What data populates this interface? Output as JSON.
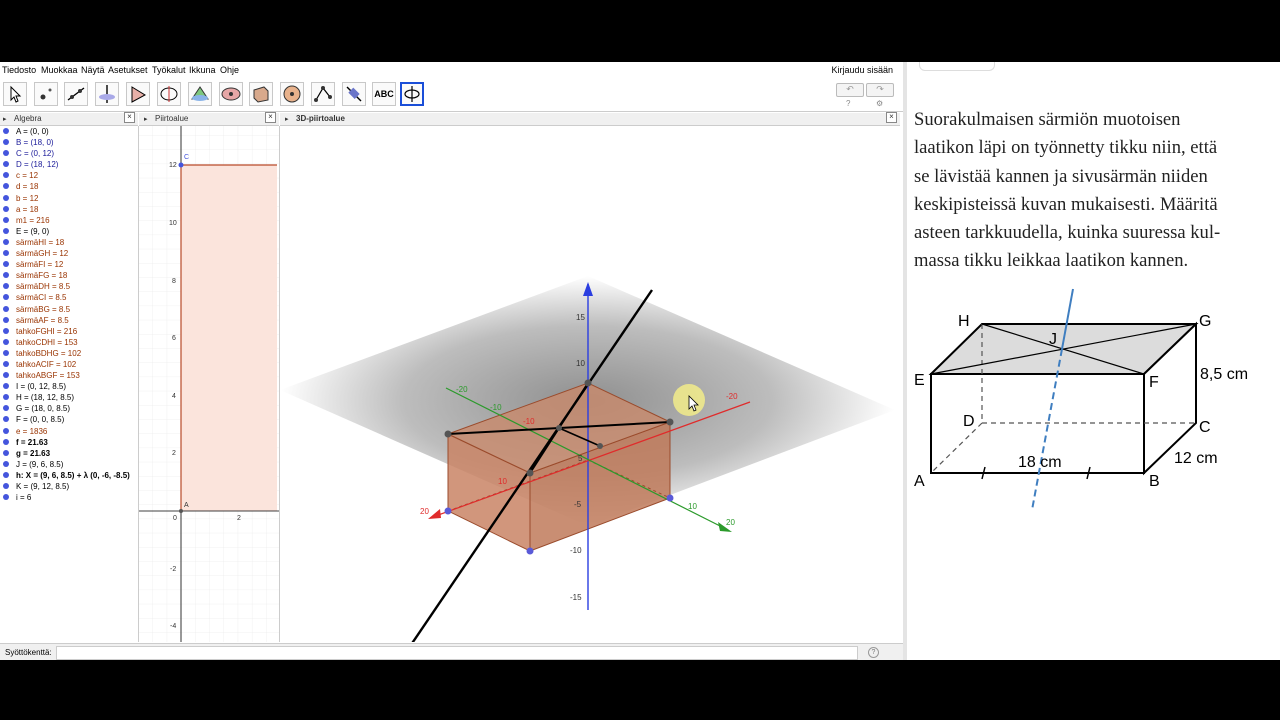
{
  "menu": {
    "items": [
      "Tiedosto",
      "Muokkaa",
      "Näytä",
      "Asetukset",
      "Työkalut",
      "Ikkuna",
      "Ohje"
    ],
    "login": "Kirjaudu sisään"
  },
  "toolbar": {
    "tools": [
      "move-tool",
      "point-tool",
      "line-tool",
      "perpendicular-tool",
      "polygon-tool",
      "circle-tool",
      "intersect-tool",
      "sphere-tool",
      "extrude-tool",
      "pyramid-tool",
      "angle-tool",
      "reflect-tool",
      "text-tool",
      "rotate-view-tool"
    ],
    "text_tool_label": "ABC",
    "undo_symbol": "↶",
    "redo_symbol": "↷",
    "help_symbol": "?",
    "settings_symbol": "⚙"
  },
  "algebra": {
    "title": "Algebra",
    "items": [
      {
        "text": "A = (0, 0)",
        "color": "#000000",
        "bold": false
      },
      {
        "text": "B = (18, 0)",
        "color": "#1a1a99",
        "bold": false
      },
      {
        "text": "C = (0, 12)",
        "color": "#1a1a99",
        "bold": false
      },
      {
        "text": "D = (18, 12)",
        "color": "#1a1a99",
        "bold": false
      },
      {
        "text": "c = 12",
        "color": "#993300",
        "bold": false
      },
      {
        "text": "d = 18",
        "color": "#993300",
        "bold": false
      },
      {
        "text": "b = 12",
        "color": "#993300",
        "bold": false
      },
      {
        "text": "a = 18",
        "color": "#993300",
        "bold": false
      },
      {
        "text": "m1 = 216",
        "color": "#993300",
        "bold": false
      },
      {
        "text": "E = (9, 0)",
        "color": "#000000",
        "bold": false
      },
      {
        "text": "särmäHI = 18",
        "color": "#993300",
        "bold": false
      },
      {
        "text": "särmäGH = 12",
        "color": "#993300",
        "bold": false
      },
      {
        "text": "särmäFI = 12",
        "color": "#993300",
        "bold": false
      },
      {
        "text": "särmäFG = 18",
        "color": "#993300",
        "bold": false
      },
      {
        "text": "särmäDH = 8.5",
        "color": "#993300",
        "bold": false
      },
      {
        "text": "särmäCI = 8.5",
        "color": "#993300",
        "bold": false
      },
      {
        "text": "särmäBG = 8.5",
        "color": "#993300",
        "bold": false
      },
      {
        "text": "särmäAF = 8.5",
        "color": "#993300",
        "bold": false
      },
      {
        "text": "tahkoFGHI = 216",
        "color": "#993300",
        "bold": false
      },
      {
        "text": "tahkoCDHI = 153",
        "color": "#993300",
        "bold": false
      },
      {
        "text": "tahkoBDHG = 102",
        "color": "#993300",
        "bold": false
      },
      {
        "text": "tahkoACIF = 102",
        "color": "#993300",
        "bold": false
      },
      {
        "text": "tahkoABGF = 153",
        "color": "#993300",
        "bold": false
      },
      {
        "text": "I = (0, 12, 8.5)",
        "color": "#000000",
        "bold": false
      },
      {
        "text": "H = (18, 12, 8.5)",
        "color": "#000000",
        "bold": false
      },
      {
        "text": "G = (18, 0, 8.5)",
        "color": "#000000",
        "bold": false
      },
      {
        "text": "F = (0, 0, 8.5)",
        "color": "#000000",
        "bold": false
      },
      {
        "text": "e = 1836",
        "color": "#993300",
        "bold": false
      },
      {
        "text": "f = 21.63",
        "color": "#000000",
        "bold": true
      },
      {
        "text": "g = 21.63",
        "color": "#000000",
        "bold": true
      },
      {
        "text": "J = (9, 6, 8.5)",
        "color": "#000000",
        "bold": false
      },
      {
        "text": "h: X = (9, 6, 8.5) + λ (0, -6, -8.5)",
        "color": "#000000",
        "bold": true
      },
      {
        "text": "K = (9, 12, 8.5)",
        "color": "#000000",
        "bold": false
      },
      {
        "text": "i = 6",
        "color": "#000000",
        "bold": false
      }
    ]
  },
  "graphics": {
    "title": "Piirtoalue",
    "y_ticks": [
      "12",
      "10",
      "8",
      "6",
      "4",
      "2",
      "-2",
      "-4"
    ],
    "x_ticks": [
      "0",
      "2"
    ],
    "point_labels": [
      "C",
      "A"
    ]
  },
  "view3d": {
    "title": "3D-piirtoalue",
    "z_ticks": [
      "15",
      "10",
      "5",
      "-5",
      "-10",
      "-15"
    ],
    "x_ticks": [
      "-20",
      "-10",
      "10",
      "20"
    ],
    "y_ticks": [
      "-20",
      "-10",
      "10",
      "20"
    ]
  },
  "input_bar": {
    "label": "Syöttökenttä:"
  },
  "problem": {
    "lines": [
      "Suorakulmaisen särmiön muotoisen",
      "laatikon läpi on työnnetty tikku niin, että",
      "se lävistää kannen ja sivusärmän niiden",
      "keskipisteissä kuvan mukaisesti. Määritä",
      "asteen tarkkuudella, kuinka suuressa kul-",
      "massa tikku leikkaa laatikon kannen."
    ],
    "figure_labels": {
      "H": "H",
      "J": "J",
      "G": "G",
      "E": "E",
      "F": "F",
      "D": "D",
      "C": "C",
      "A": "A",
      "B": "B",
      "height": "8,5 cm",
      "length": "18 cm",
      "depth": "12 cm"
    }
  }
}
